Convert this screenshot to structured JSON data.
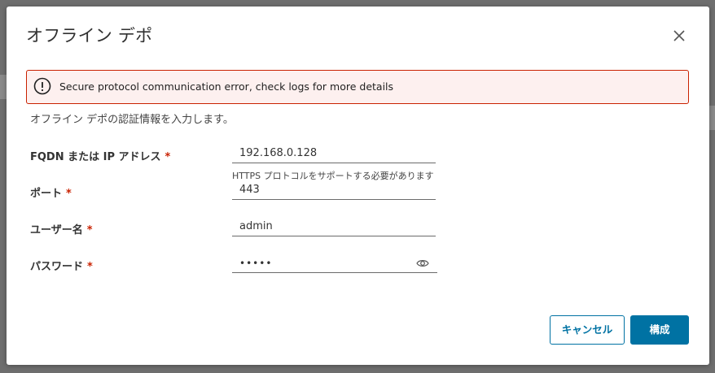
{
  "dialog": {
    "title": "オフライン デポ",
    "alert_text": "Secure protocol communication error, check logs for more details",
    "subtitle": "オフライン デポの認証情報を入力します。"
  },
  "form": {
    "host_label": "FQDN または IP アドレス",
    "host_value": "192.168.0.128",
    "host_helper": "HTTPS プロトコルをサポートする必要があります",
    "port_label": "ポート",
    "port_value": "443",
    "user_label": "ユーザー名",
    "user_value": "admin",
    "password_label": "パスワード",
    "password_value": "•••••",
    "required_mark": "*"
  },
  "buttons": {
    "cancel": "キャンセル",
    "ok": "構成"
  },
  "colors": {
    "primary": "#0072a3",
    "error": "#c92100",
    "alert_bg": "#fdf0ef"
  },
  "icons": {
    "close": "close-icon",
    "alert": "exclamation-circle-icon",
    "eye": "eye-icon"
  }
}
